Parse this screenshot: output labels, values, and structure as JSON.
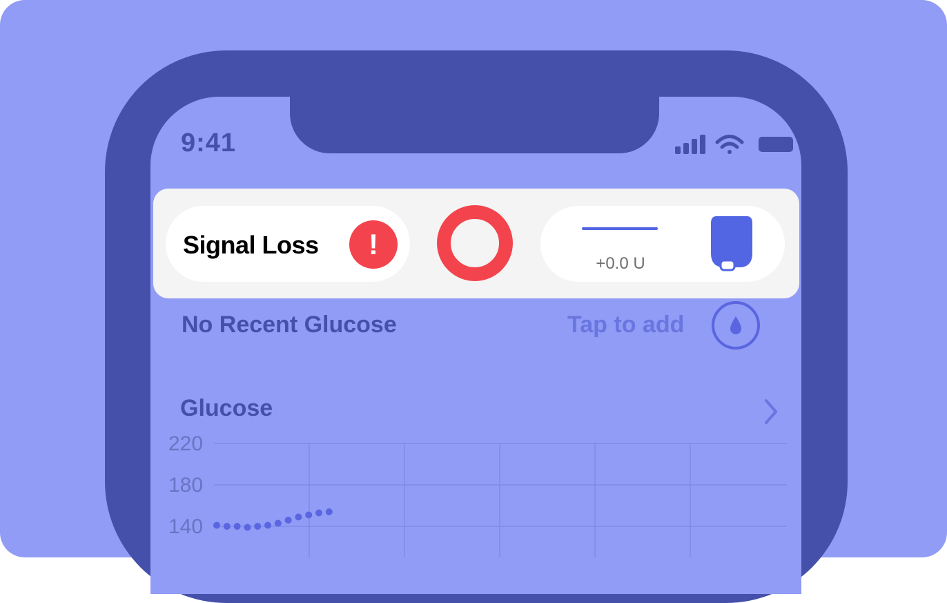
{
  "status_bar": {
    "time": "9:41",
    "icons": [
      "signal-bars-icon",
      "wifi-icon",
      "battery-icon"
    ]
  },
  "hud": {
    "cgm_status": "Signal Loss",
    "cgm_alert_icon": "exclamation-icon",
    "cgm_alert_glyph": "!",
    "loop_status_icon": "loop-ring-icon",
    "insulin_delivered": "+0.0 U",
    "pump_icon": "pump-icon"
  },
  "glucose_entry": {
    "status": "No Recent Glucose",
    "action_label": "Tap to add",
    "action_icon": "blood-drop-icon"
  },
  "glucose_chart_section": {
    "title": "Glucose",
    "chevron_icon": "chevron-right-icon"
  },
  "chart_data": {
    "type": "scatter",
    "y_ticks": [
      "220",
      "180",
      "140"
    ],
    "ylim": [
      110,
      220
    ],
    "grid": true,
    "series": [
      {
        "x": [
          0,
          1,
          2,
          3,
          4,
          5,
          6,
          7,
          8,
          9,
          10,
          11
        ],
        "y": [
          141,
          140,
          140,
          139,
          140,
          141,
          143,
          146,
          149,
          151,
          153,
          154
        ]
      }
    ]
  },
  "colors": {
    "card_background": "#909cf5",
    "phone_frame": "#4450a9",
    "alert_red": "#f3444d",
    "accent_blue": "#5266e4",
    "hud_background": "#f4f4f4"
  }
}
